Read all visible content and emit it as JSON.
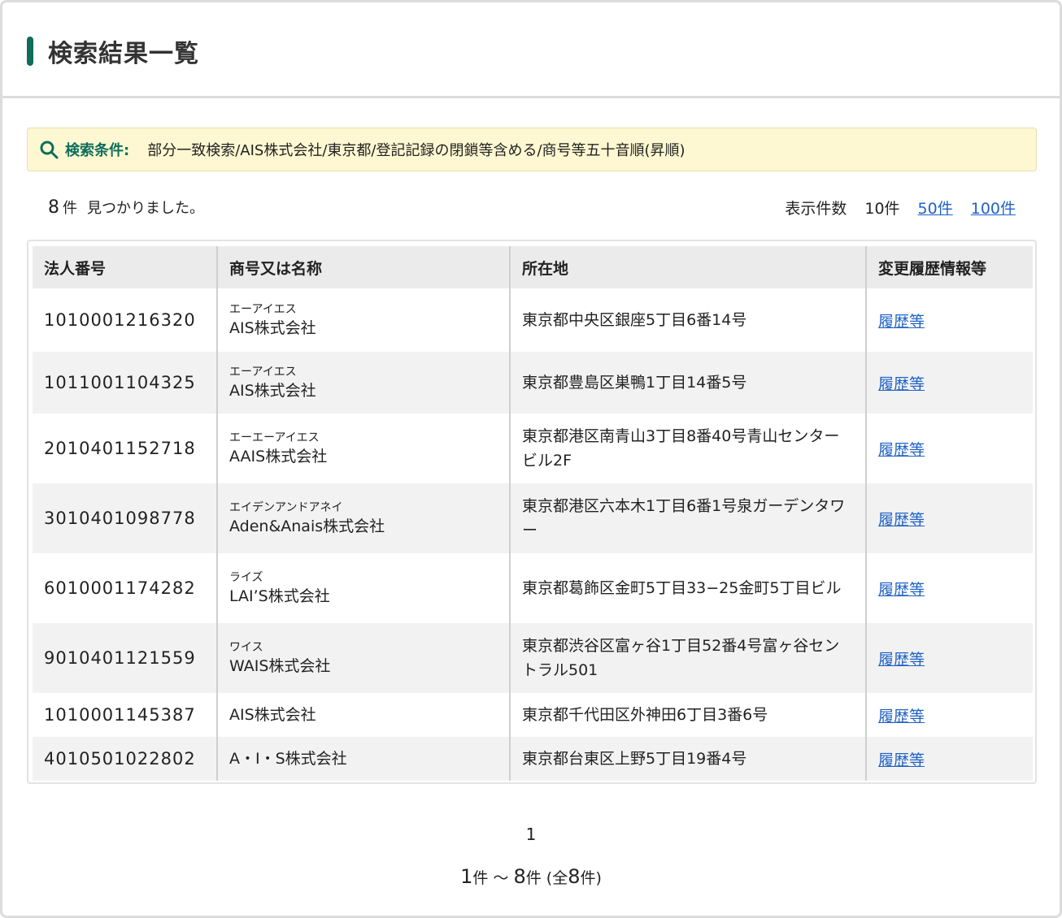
{
  "header": {
    "title": "検索結果一覧"
  },
  "condition": {
    "icon": "search-icon",
    "label": "検索条件:",
    "text": "部分一致検索/AIS株式会社/東京都/登記記録の閉鎖等含める/商号等五十音順(昇順)"
  },
  "count": {
    "number": "8",
    "unit": "件",
    "message": "見つかりました。",
    "display_label": "表示件数",
    "current": "10件",
    "options": [
      "50件",
      "100件"
    ]
  },
  "table": {
    "headers": [
      "法人番号",
      "商号又は名称",
      "所在地",
      "変更履歴情報等"
    ],
    "rows": [
      {
        "number": "1010001216320",
        "kana": "エーアイエス",
        "name": "AIS株式会社",
        "address": "東京都中央区銀座5丁目6番14号",
        "history": "履歴等"
      },
      {
        "number": "1011001104325",
        "kana": "エーアイエス",
        "name": "AIS株式会社",
        "address": "東京都豊島区巣鴨1丁目14番5号",
        "history": "履歴等"
      },
      {
        "number": "2010401152718",
        "kana": "エーエーアイエス",
        "name": "AAIS株式会社",
        "address": "東京都港区南青山3丁目8番40号青山センタービル2F",
        "history": "履歴等"
      },
      {
        "number": "3010401098778",
        "kana": "エイデンアンドアネイ",
        "name": "Aden&Anais株式会社",
        "address": "東京都港区六本木1丁目6番1号泉ガーデンタワー",
        "history": "履歴等"
      },
      {
        "number": "6010001174282",
        "kana": "ライズ",
        "name": "LAI’S株式会社",
        "address": "東京都葛飾区金町5丁目33−25金町5丁目ビル",
        "history": "履歴等"
      },
      {
        "number": "9010401121559",
        "kana": "ワイス",
        "name": "WAIS株式会社",
        "address": "東京都渋谷区富ヶ谷1丁目52番4号富ヶ谷セントラル501",
        "history": "履歴等"
      },
      {
        "number": "1010001145387",
        "kana": "",
        "name": "AIS株式会社",
        "address": "東京都千代田区外神田6丁目3番6号",
        "history": "履歴等"
      },
      {
        "number": "4010501022802",
        "kana": "",
        "name": "A・I・S株式会社",
        "address": "東京都台東区上野5丁目19番4号",
        "history": "履歴等"
      }
    ]
  },
  "pagination": {
    "page": "1",
    "range_start": "1",
    "range_sep": "件 ～ ",
    "range_end": "8",
    "range_total_prefix": "件 (全",
    "range_total": "8",
    "range_total_suffix": "件)"
  },
  "colors": {
    "accent": "#0f6d5c",
    "link": "#1f62c6",
    "condition_bg": "#fdf8d1"
  }
}
